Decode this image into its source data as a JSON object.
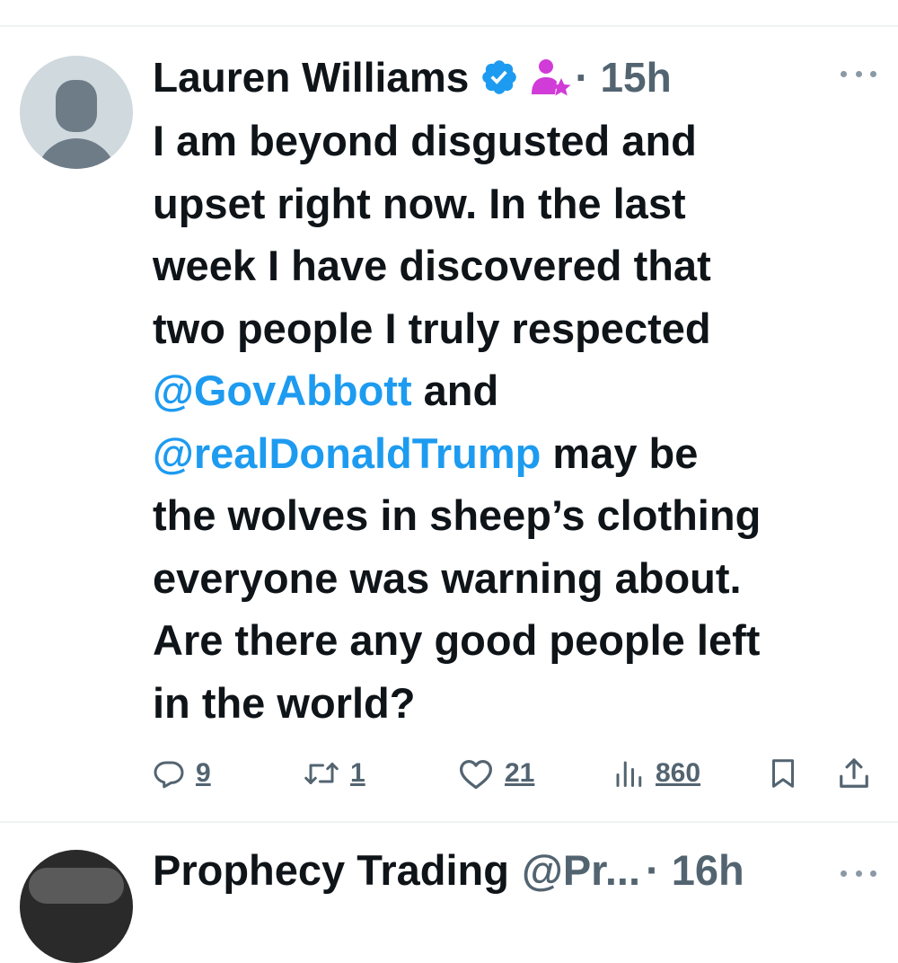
{
  "tweet": {
    "author_name": "Lauren Williams",
    "time": "· 15h",
    "text_lines": [
      [
        {
          "t": "I am beyond disgusted and"
        }
      ],
      [
        {
          "t": "upset right now. In the last"
        }
      ],
      [
        {
          "t": "week I have discovered that"
        }
      ],
      [
        {
          "t": "two people I truly respected"
        }
      ],
      [
        {
          "t": "@GovAbbott",
          "mention": true
        },
        {
          "t": " and"
        }
      ],
      [
        {
          "t": "@realDonaldTrump",
          "mention": true
        },
        {
          "t": " may be"
        }
      ],
      [
        {
          "t": "the wolves in sheep’s clothing"
        }
      ],
      [
        {
          "t": "everyone was warning about."
        }
      ],
      [
        {
          "t": "Are there any good people left"
        }
      ],
      [
        {
          "t": "in the world?"
        }
      ]
    ],
    "actions": {
      "reply_count": "9",
      "retweet_count": "1",
      "like_count": "21",
      "view_count": "860"
    },
    "icons": {
      "verified": "verified-badge-icon",
      "role": "person-star-icon",
      "more": "more-dots-icon",
      "reply": "reply-icon",
      "retweet": "retweet-icon",
      "like": "heart-icon",
      "views": "views-icon",
      "bookmark": "bookmark-icon",
      "share": "share-icon"
    }
  },
  "next_tweet": {
    "author_name": "Prophecy Trading",
    "handle": "@Pr...",
    "time": "· 16h"
  },
  "colors": {
    "text": "#0f1419",
    "secondary": "#536471",
    "link": "#1d9bf0",
    "verified": "#1d9bf0",
    "role_icon": "#d13bd8",
    "divider": "#eff3f4"
  }
}
